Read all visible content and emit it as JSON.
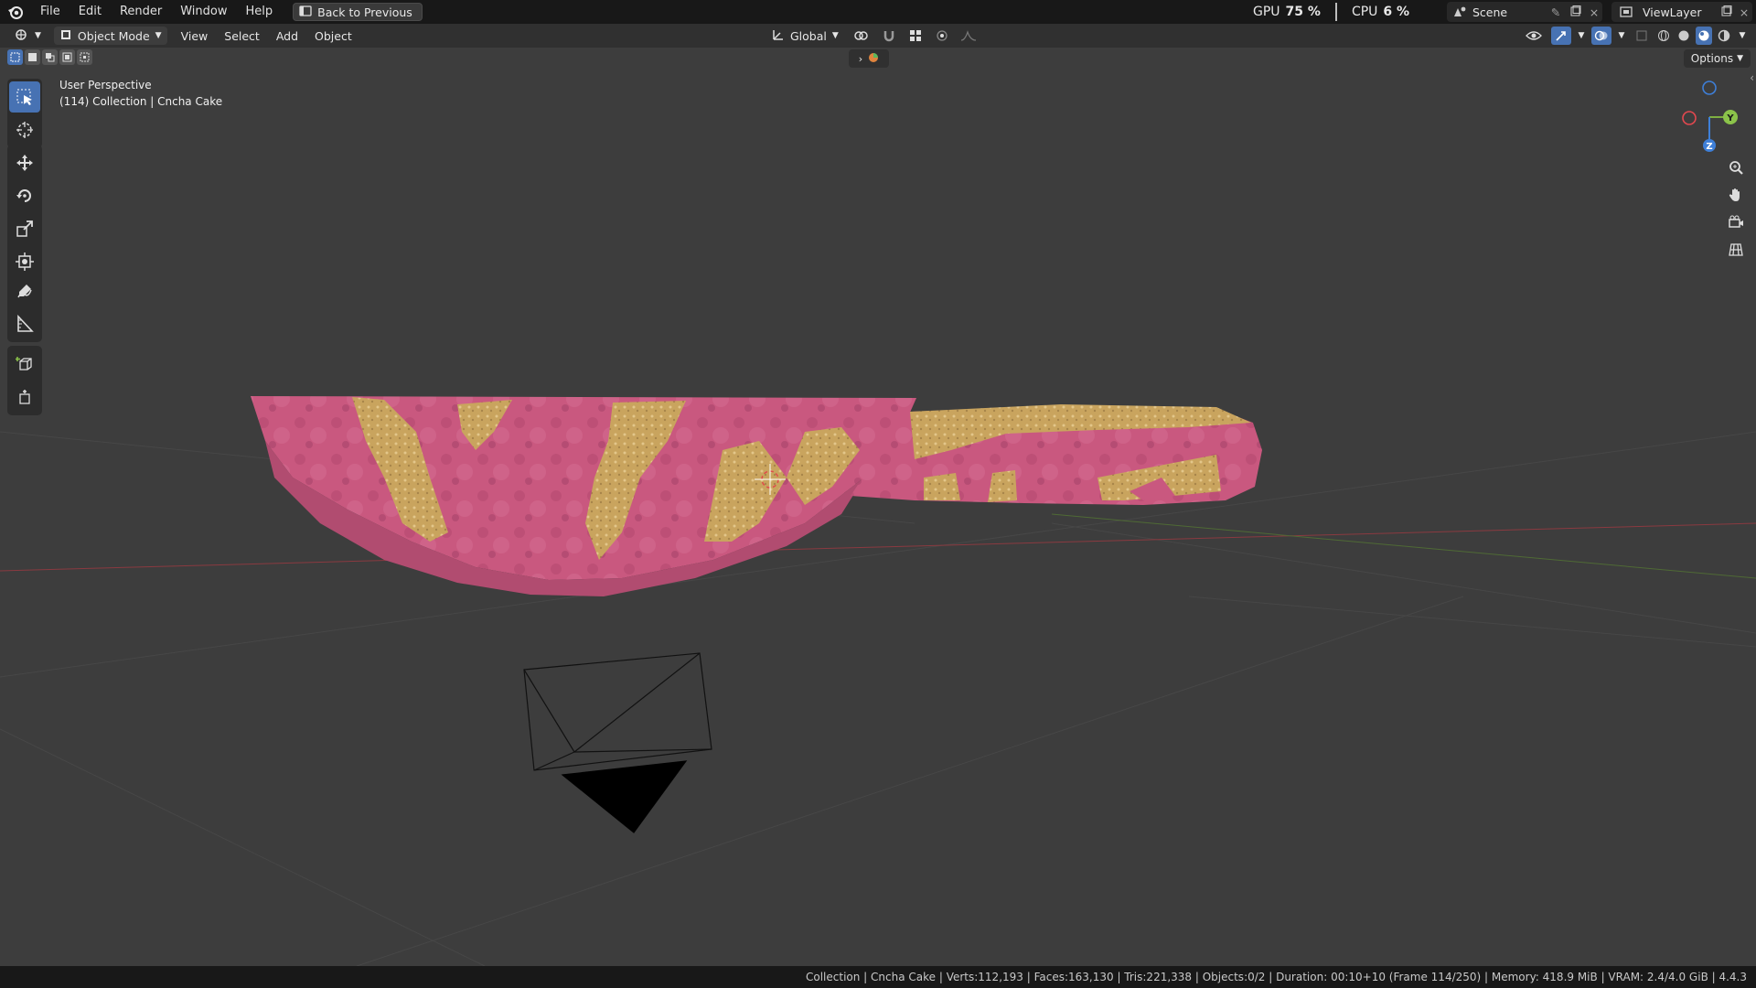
{
  "menubar": {
    "items": [
      "File",
      "Edit",
      "Render",
      "Window",
      "Help"
    ],
    "back_button": "Back to Previous"
  },
  "performance": {
    "gpu_label": "GPU",
    "gpu_value": "75 %",
    "cpu_label": "CPU",
    "cpu_value": "6 %"
  },
  "scene": {
    "name": "Scene"
  },
  "viewlayer": {
    "name": "ViewLayer"
  },
  "viewport_header": {
    "mode": "Object Mode",
    "menus": [
      "View",
      "Select",
      "Add",
      "Object"
    ],
    "transform_orientation": "Global",
    "options_label": "Options"
  },
  "viewport": {
    "perspective": "User Perspective",
    "collection_info": "(114) Collection | Cncha Cake",
    "gizmo_axes": {
      "x": "X",
      "y": "Y",
      "z": "Z"
    }
  },
  "statusbar": {
    "text": "Collection | Cncha Cake | Verts:112,193 | Faces:163,130 | Tris:221,338 | Objects:0/2 | Duration: 00:10+10 (Frame 114/250) | Memory: 418.9 MiB | VRAM: 2.4/4.0 GiB | 4.4.3"
  },
  "colors": {
    "accent": "#4772b3",
    "cake_pink": "#c9587f",
    "cake_gold": "#c9a45e",
    "axis_x": "#e2484f",
    "axis_y": "#8bc34a",
    "axis_z": "#3e7fd8"
  },
  "icons": [
    "blender-logo-icon",
    "back-icon",
    "editor-type-icon",
    "object-mode-icon",
    "transform-orientation-icon",
    "pivot-icon",
    "snap-icon",
    "proportional-edit-icon",
    "visibility-icon",
    "gizmo-icon",
    "overlay-icon",
    "xray-icon",
    "shading-wireframe-icon",
    "shading-solid-icon",
    "shading-material-icon",
    "shading-rendered-icon",
    "select-box-icon",
    "cursor-icon",
    "move-icon",
    "rotate-icon",
    "scale-icon",
    "transform-icon",
    "annotate-icon",
    "measure-icon",
    "add-cube-icon",
    "add-object-icon",
    "zoom-icon",
    "pan-hand-icon",
    "camera-view-icon",
    "grid-view-icon"
  ]
}
